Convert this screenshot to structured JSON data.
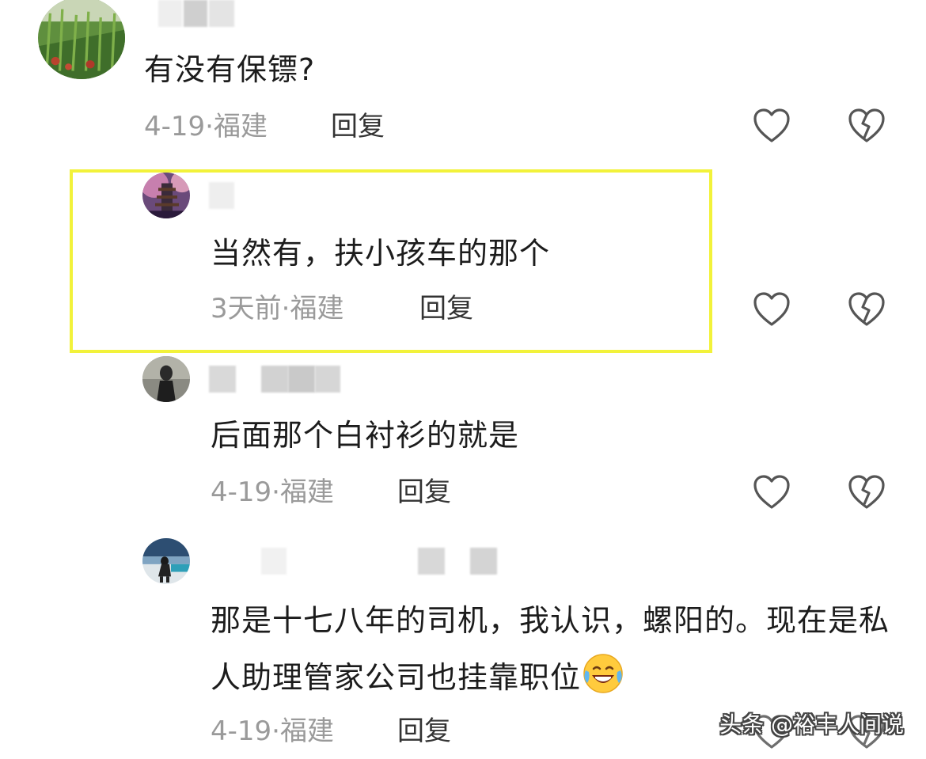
{
  "comments": [
    {
      "text": "有没有保镖?",
      "date": "4-19",
      "sep": "·",
      "location": "福建",
      "reply_label": "回复",
      "like_icon": "heart-outline-icon",
      "dislike_icon": "broken-heart-icon"
    },
    {
      "text": "当然有，扶小孩车的那个",
      "date": "3天前",
      "sep": "·",
      "location": "福建",
      "reply_label": "回复",
      "highlight_color": "#f2f23a",
      "like_icon": "heart-outline-icon",
      "dislike_icon": "broken-heart-icon"
    },
    {
      "text": "后面那个白衬衫的就是",
      "date": "4-19",
      "sep": "·",
      "location": "福建",
      "reply_label": "回复",
      "like_icon": "heart-outline-icon",
      "dislike_icon": "broken-heart-icon"
    },
    {
      "text": "那是十七八年的司机，我认识，螺阳的。现在是私人助理管家公司也挂靠职位",
      "emoji": "grinning-tears-emoji",
      "date": "4-19",
      "sep": "·",
      "location": "福建",
      "reply_label": "回复",
      "like_icon": "heart-outline-icon",
      "dislike_icon": "broken-heart-icon"
    }
  ],
  "watermark": "头条 @裕丰人间说",
  "colors": {
    "highlight": "#f2f23a",
    "meta_text": "#9a9a9a",
    "body_text": "#1c1c1c"
  }
}
